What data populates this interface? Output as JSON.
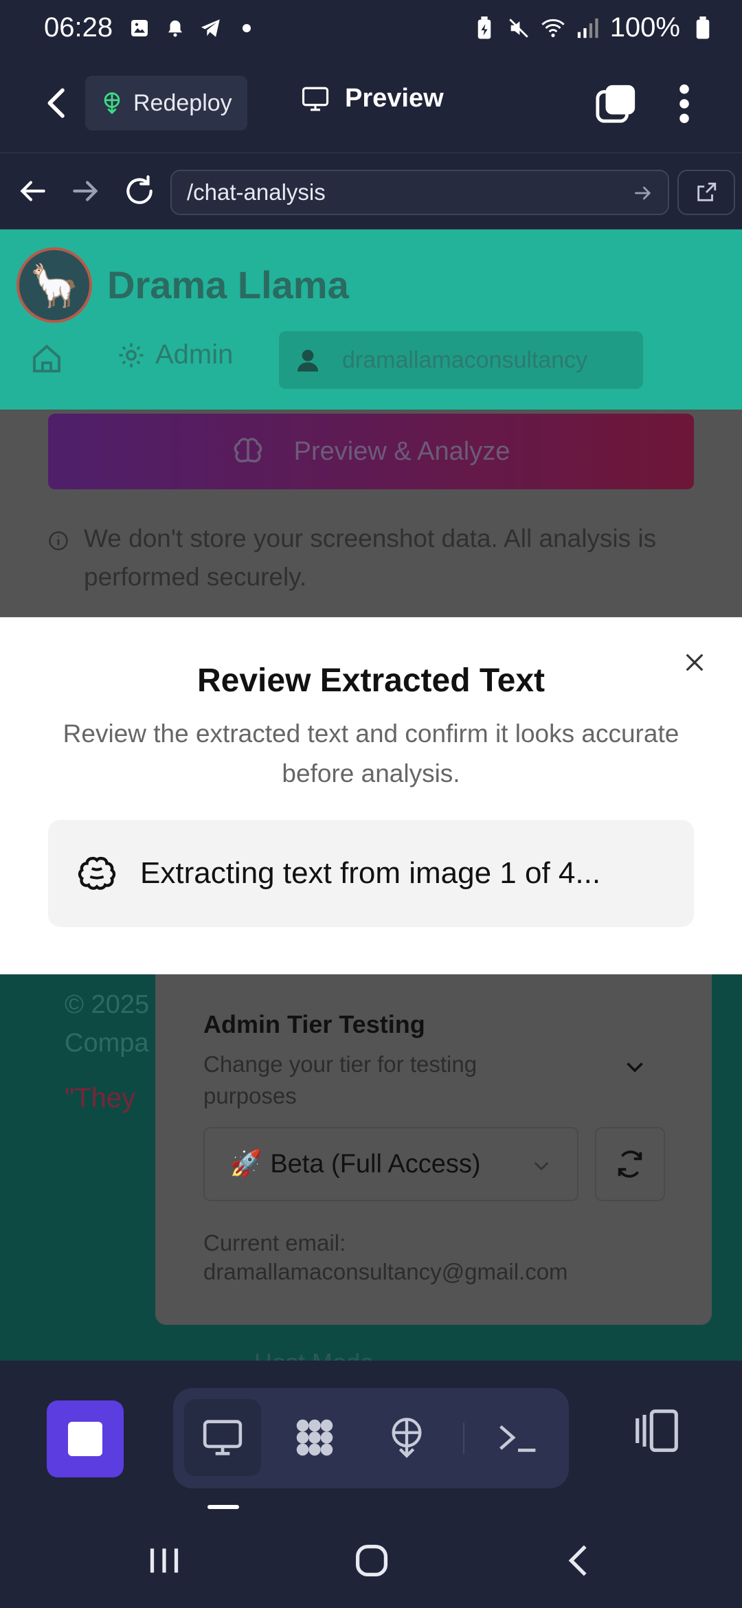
{
  "status_bar": {
    "time": "06:28",
    "battery": "100%",
    "left_icons": [
      "image-icon",
      "bell-icon",
      "telegram-icon",
      "dot-icon"
    ],
    "right_icons": [
      "battery-saver-icon",
      "mute-icon",
      "wifi-icon",
      "signal-icon",
      "battery-icon"
    ]
  },
  "app_bar": {
    "redeploy_label": "Redeploy",
    "preview_label": "Preview"
  },
  "url_bar": {
    "url": "/chat-analysis"
  },
  "site": {
    "title": "Drama Llama",
    "nav": {
      "admin_label": "Admin",
      "user_label": "dramallamaconsultancy"
    },
    "analyze_button": "Preview & Analyze",
    "privacy_note": "We don't store your screenshot data. All analysis is performed securely.",
    "copyright_partial": "© 2025\nCompa",
    "quote_partial": "\"They",
    "admin_panel": {
      "title": "Admin Tier Testing",
      "subtitle": "Change your tier for testing purposes",
      "tier_value": "Beta (Full Access)",
      "tier_emoji": "🚀",
      "email_label": "Current email:",
      "email_value": "dramallamaconsultancy@gmail.com"
    },
    "ghost_text": "Host Mode"
  },
  "modal": {
    "title": "Review Extracted Text",
    "description": "Review the extracted text and confirm it looks accurate before analysis.",
    "status": "Extracting text from image 1 of 4..."
  },
  "colors": {
    "accent": "#5b3de0",
    "teal": "#23b39a",
    "dark_bg": "#1f2438"
  }
}
